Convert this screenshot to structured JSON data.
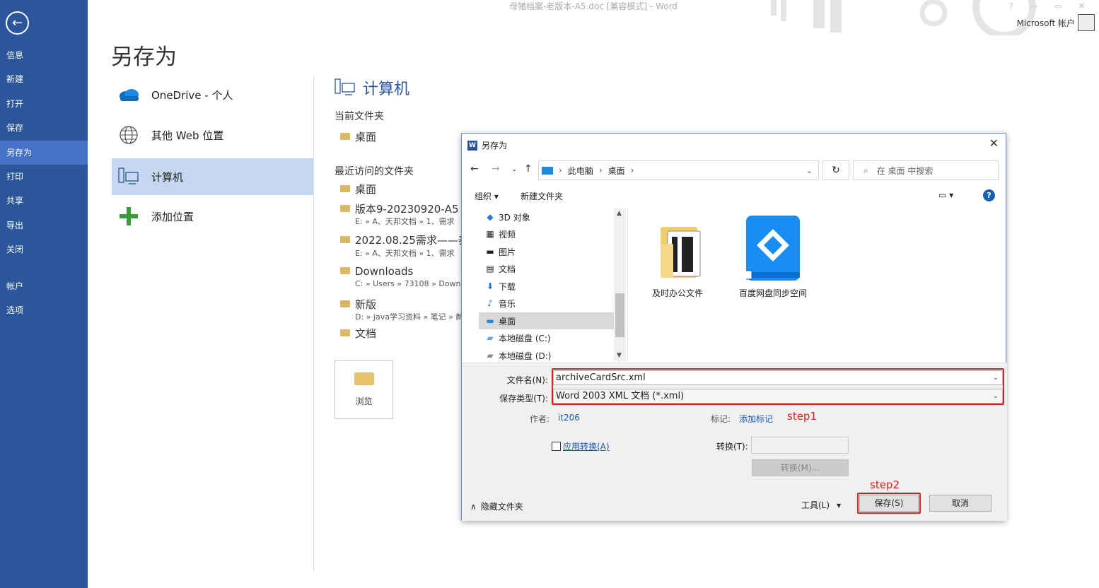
{
  "window": {
    "title": "母猪档案-老版本-A5.doc [兼容模式] - Word",
    "account": "Microsoft 帐户",
    "controls": "? — ▭ ✕"
  },
  "nav": {
    "back_icon": "back-arrow-icon",
    "items": [
      "信息",
      "新建",
      "打开",
      "保存",
      "另存为",
      "打印",
      "共享",
      "导出",
      "关闭",
      "帐户",
      "选项"
    ],
    "active": "另存为"
  },
  "page": {
    "title": "另存为"
  },
  "locations": [
    {
      "label": "OneDrive - 个人",
      "icon": "cloud-icon"
    },
    {
      "label": "其他 Web 位置",
      "icon": "globe-icon"
    },
    {
      "label": "计算机",
      "icon": "computer-icon"
    },
    {
      "label": "添加位置",
      "icon": "plus-icon"
    }
  ],
  "computer": {
    "heading": "计算机",
    "current_folder_label": "当前文件夹",
    "current_folder": "桌面",
    "recent_label": "最近访问的文件夹",
    "recent": [
      {
        "name": "桌面",
        "path": ""
      },
      {
        "name": "版本9-20230920-A5",
        "path": "E: » A、天邦文档 » 1、需求"
      },
      {
        "name": "2022.08.25需求——养",
        "path": "E: » A、天邦文档 » 1、需求"
      },
      {
        "name": "Downloads",
        "path": "C: » Users » 73108 » Down"
      },
      {
        "name": "新版",
        "path": "D: » java学习资料 » 笔记 » 新"
      },
      {
        "name": "文档",
        "path": ""
      }
    ],
    "browse": "浏览"
  },
  "dialog": {
    "title": "另存为",
    "breadcrumb": [
      "此电脑",
      "桌面"
    ],
    "search_placeholder": "在 桌面 中搜索",
    "organize": "组织 ▾",
    "new_folder": "新建文件夹",
    "tree": [
      {
        "label": "3D 对象",
        "icon": "cube-icon"
      },
      {
        "label": "视频",
        "icon": "video-icon"
      },
      {
        "label": "图片",
        "icon": "picture-icon"
      },
      {
        "label": "文档",
        "icon": "document-icon"
      },
      {
        "label": "下载",
        "icon": "download-icon"
      },
      {
        "label": "音乐",
        "icon": "music-icon"
      },
      {
        "label": "桌面",
        "icon": "desktop-icon",
        "selected": true
      },
      {
        "label": "本地磁盘 (C:)",
        "icon": "drive-icon"
      },
      {
        "label": "本地磁盘 (D:)",
        "icon": "drive-icon"
      }
    ],
    "files": [
      {
        "label": "及时办公文件",
        "icon": "folder-icon"
      },
      {
        "label": "百度网盘同步空间",
        "icon": "baidu-netdisk-icon"
      }
    ],
    "filename_label": "文件名(N):",
    "filename_value": "archiveCardSrc.xml",
    "filetype_label": "保存类型(T):",
    "filetype_value": "Word 2003 XML 文档 (*.xml)",
    "author_label": "作者:",
    "author_value": "it206",
    "tags_label": "标记:",
    "tags_value": "添加标记",
    "apply_transform": "应用转换(A)",
    "transform_label": "转换(T):",
    "transform_button": "转换(M)...",
    "hide_folders": "隐藏文件夹",
    "tools": "工具(L)",
    "save": "保存(S)",
    "cancel": "取消"
  },
  "annotations": {
    "step1": "step1",
    "step2": "step2",
    "color": "#e02020"
  }
}
